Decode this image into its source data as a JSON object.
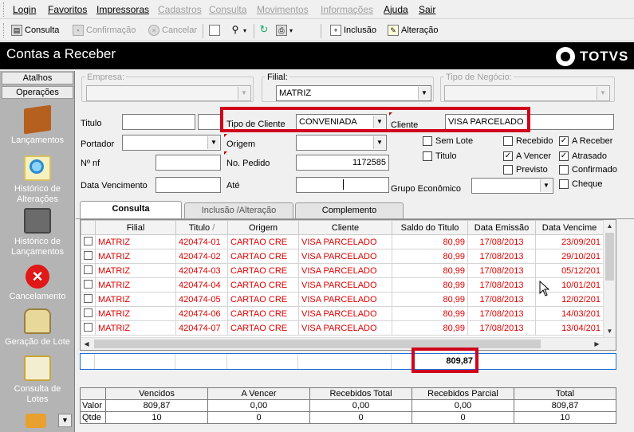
{
  "menu": {
    "items": [
      {
        "label": "Login",
        "enabled": true
      },
      {
        "label": "Favoritos",
        "enabled": true
      },
      {
        "label": "Impressoras",
        "enabled": true
      },
      {
        "label": "Cadastros",
        "enabled": false
      },
      {
        "label": "Consulta",
        "enabled": false
      },
      {
        "label": "Movimentos",
        "enabled": false
      },
      {
        "label": "Informações",
        "enabled": false
      },
      {
        "label": "Ajuda",
        "enabled": true
      },
      {
        "label": "Sair",
        "enabled": true
      }
    ]
  },
  "toolbar": {
    "consulta": "Consulta",
    "confirmacao": "Confirmação",
    "cancelar": "Cancelar",
    "inclusao": "Inclusão",
    "alteracao": "Alteração"
  },
  "app": {
    "title": "Contas a Receber",
    "logo": "TOTVS"
  },
  "sidebar": {
    "tab_atalhos": "Atalhos",
    "tab_operacoes": "Operações",
    "items": [
      {
        "label": "Lançamentos",
        "icon": "box-icon"
      },
      {
        "label": "Histórico de Alterações",
        "icon": "magnifier-icon"
      },
      {
        "label": "Histórico de Lançamentos",
        "icon": "stack-icon"
      },
      {
        "label": "Cancelamento",
        "icon": "cancel-icon"
      },
      {
        "label": "Geração de Lote",
        "icon": "bag-icon"
      },
      {
        "label": "Consulta de Lotes",
        "icon": "clipboard-icon"
      }
    ]
  },
  "filters": {
    "empresa_label": "Empresa:",
    "empresa_value": "",
    "filial_label": "Filial:",
    "filial_value": "MATRIZ",
    "tipo_negocio_label": "Tipo de Negócio:",
    "tipo_negocio_value": "",
    "titulo_label": "Titulo",
    "tipo_cliente_label": "Tipo de Cliente",
    "tipo_cliente_value": "CONVENIADA",
    "cliente_label": "Cliente",
    "cliente_value": "VISA PARCELADO",
    "portador_label": "Portador",
    "origem_label": "Origem",
    "nnf_label": "Nº nf",
    "nopedido_label": "No. Pedido",
    "nopedido_value": "1172585",
    "datavenc_label": "Data Vencimento",
    "ate_label": "Até",
    "grupo_label": "Grupo Econômico"
  },
  "checks": [
    {
      "label": "Sem Lote",
      "checked": false
    },
    {
      "label": "Titulo",
      "checked": false
    },
    {
      "label": "Recebido",
      "checked": false
    },
    {
      "label": "A Vencer",
      "checked": true
    },
    {
      "label": "Previsto",
      "checked": false
    },
    {
      "label": "A Receber",
      "checked": true
    },
    {
      "label": "Atrasado",
      "checked": true
    },
    {
      "label": "Confirmado",
      "checked": false
    },
    {
      "label": "Cheque",
      "checked": false
    }
  ],
  "tabs": [
    {
      "label": "Consulta",
      "active": true
    },
    {
      "label": "Inclusão /Alteração",
      "active": false
    },
    {
      "label": "Complemento",
      "active": false
    }
  ],
  "grid": {
    "columns": [
      "Filial",
      "Titulo",
      "Origem",
      "Cliente",
      "Saldo do Titulo",
      "Data Emissão",
      "Data Vencime"
    ],
    "sort_marker": "/",
    "rows": [
      [
        "MATRIZ",
        "420474-01",
        "CARTAO CRE",
        "VISA PARCELADO",
        "80,99",
        "17/08/2013",
        "23/09/201"
      ],
      [
        "MATRIZ",
        "420474-02",
        "CARTAO CRE",
        "VISA PARCELADO",
        "80,99",
        "17/08/2013",
        "29/10/201"
      ],
      [
        "MATRIZ",
        "420474-03",
        "CARTAO CRE",
        "VISA PARCELADO",
        "80,99",
        "17/08/2013",
        "05/12/201"
      ],
      [
        "MATRIZ",
        "420474-04",
        "CARTAO CRE",
        "VISA PARCELADO",
        "80,99",
        "17/08/2013",
        "10/01/201"
      ],
      [
        "MATRIZ",
        "420474-05",
        "CARTAO CRE",
        "VISA PARCELADO",
        "80,99",
        "17/08/2013",
        "12/02/201"
      ],
      [
        "MATRIZ",
        "420474-06",
        "CARTAO CRE",
        "VISA PARCELADO",
        "80,99",
        "17/08/2013",
        "14/03/201"
      ],
      [
        "MATRIZ",
        "420474-07",
        "CARTAO CRE",
        "VISA PARCELADO",
        "80,99",
        "17/08/2013",
        "13/04/201"
      ]
    ],
    "total": "809,87"
  },
  "summary": {
    "headers": [
      "Vencidos",
      "A Vencer",
      "Recebidos Total",
      "Recebidos Parcial",
      "Total"
    ],
    "rows": [
      {
        "label": "Valor",
        "values": [
          "809,87",
          "0,00",
          "0,00",
          "0,00",
          "809,87"
        ]
      },
      {
        "label": "Qtde",
        "values": [
          "10",
          "0",
          "0",
          "0",
          "10"
        ]
      }
    ]
  },
  "colors": {
    "highlight": "#d0021b",
    "row_text": "#e00000",
    "sidebar": "#b4b4b4"
  }
}
